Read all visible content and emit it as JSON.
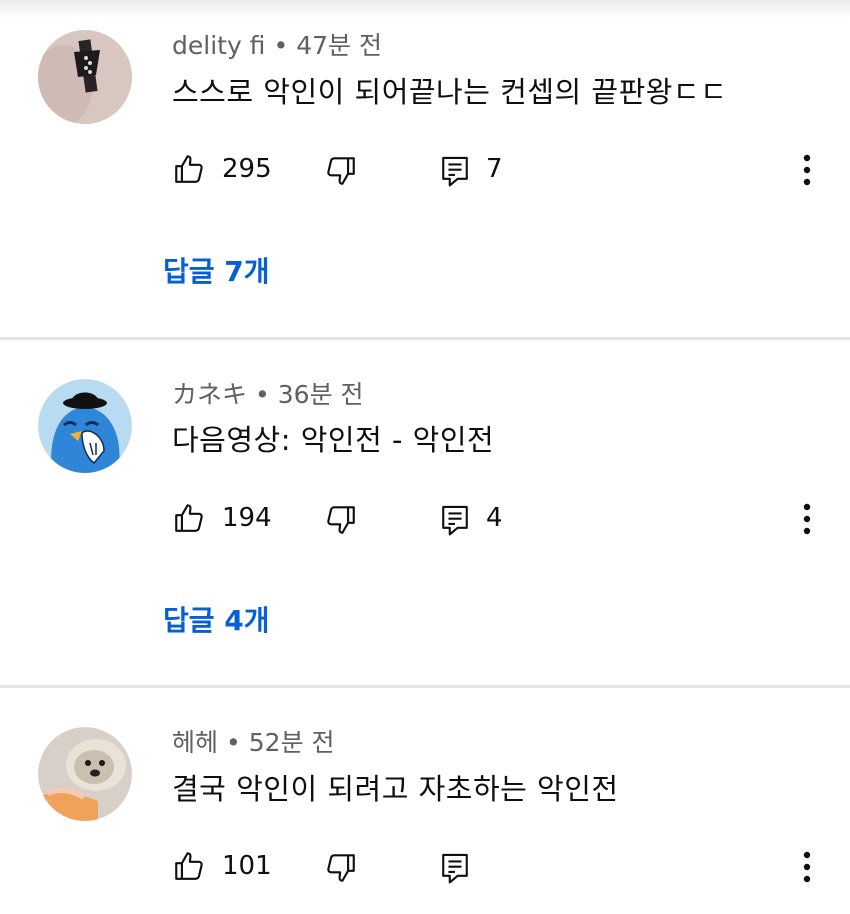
{
  "comments": [
    {
      "author": "delity fi",
      "separator": "•",
      "time": "47분 전",
      "text": "스스로 악인이 되어끝나는 컨셉의 끝판왕ㄷㄷ",
      "likes": "295",
      "reply_count": "7",
      "replies_link": "답글 7개",
      "avatar_icon": "guitar-avatar"
    },
    {
      "author": "カネキ",
      "separator": "•",
      "time": "36분 전",
      "text": "다음영상: 악인전 - 악인전",
      "likes": "194",
      "reply_count": "4",
      "replies_link": "답글 4개",
      "avatar_icon": "blue-bird-avatar"
    },
    {
      "author": "헤헤",
      "separator": "•",
      "time": "52분 전",
      "text": "결국 악인이 되려고 자초하는 악인전",
      "likes": "101",
      "reply_count": "",
      "avatar_icon": "dog-avatar"
    }
  ],
  "colors": {
    "link": "#065fd4",
    "meta": "#606060",
    "divider": "#e5e5e5"
  }
}
